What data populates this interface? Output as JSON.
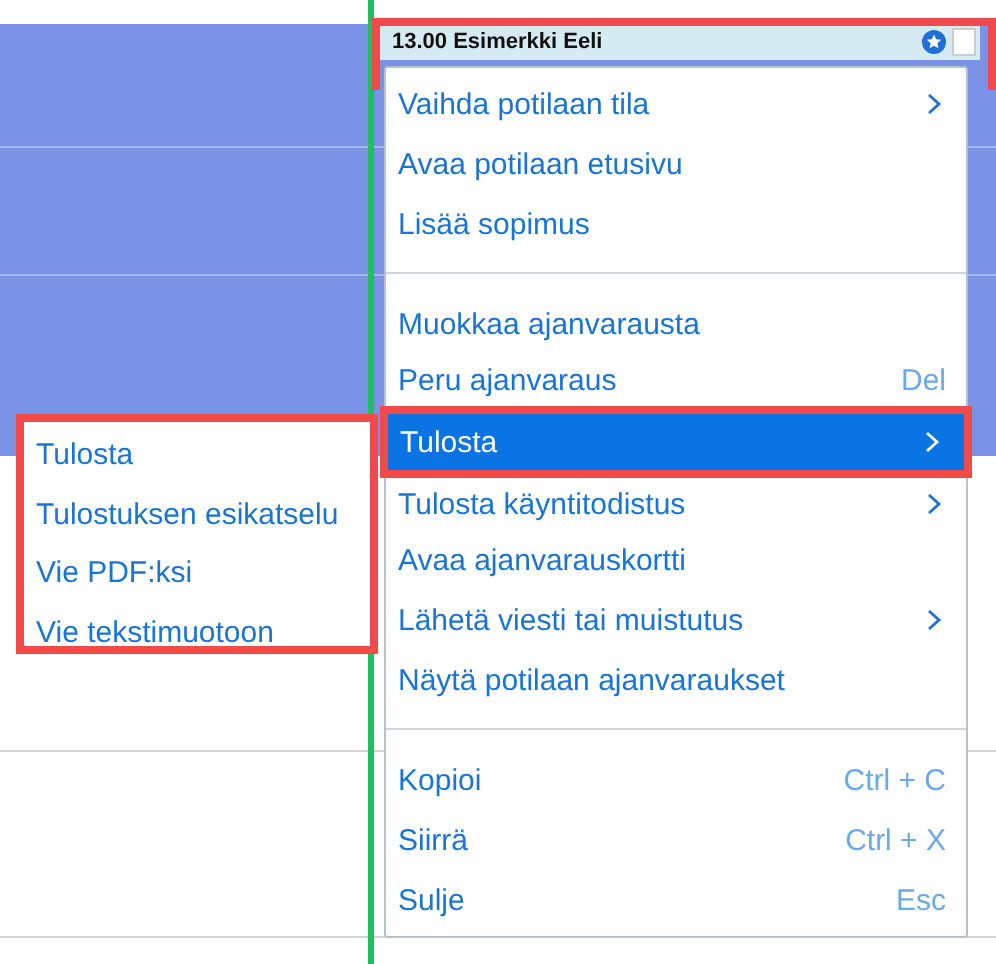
{
  "appointment": {
    "title": "13.00 Esimerkki Eeli",
    "checked": false
  },
  "context_menu": {
    "items": [
      {
        "kind": "item",
        "label": "Vaihda potilaan tila",
        "submenu": true,
        "selected": false
      },
      {
        "kind": "item",
        "label": "Avaa potilaan etusivu",
        "submenu": false,
        "selected": false
      },
      {
        "kind": "item",
        "label": "Lisää sopimus",
        "submenu": false,
        "selected": false
      },
      {
        "kind": "separator"
      },
      {
        "kind": "item",
        "label": "Muokkaa ajanvarausta",
        "submenu": false,
        "selected": false
      },
      {
        "kind": "item",
        "label": "Peru ajanvaraus",
        "shortcut": "Del",
        "submenu": false,
        "selected": false
      },
      {
        "kind": "item",
        "label": "Tulosta",
        "submenu": true,
        "selected": true
      },
      {
        "kind": "item",
        "label": "Tulosta käyntitodistus",
        "submenu": true,
        "selected": false
      },
      {
        "kind": "item",
        "label": "Avaa ajanvarauskortti",
        "submenu": false,
        "selected": false
      },
      {
        "kind": "item",
        "label": "Lähetä viesti tai muistutus",
        "submenu": true,
        "selected": false
      },
      {
        "kind": "item",
        "label": "Näytä potilaan ajanvaraukset",
        "submenu": false,
        "selected": false
      },
      {
        "kind": "separator"
      },
      {
        "kind": "item",
        "label": "Kopioi",
        "shortcut": "Ctrl + C",
        "submenu": false,
        "selected": false
      },
      {
        "kind": "item",
        "label": "Siirrä",
        "shortcut": "Ctrl + X",
        "submenu": false,
        "selected": false
      },
      {
        "kind": "item",
        "label": "Sulje",
        "shortcut": "Esc",
        "submenu": false,
        "selected": false
      }
    ]
  },
  "submenu": {
    "items": [
      "Tulosta",
      "Tulostuksen esikatselu",
      "Vie PDF:ksi",
      "Vie tekstimuotoon"
    ]
  }
}
